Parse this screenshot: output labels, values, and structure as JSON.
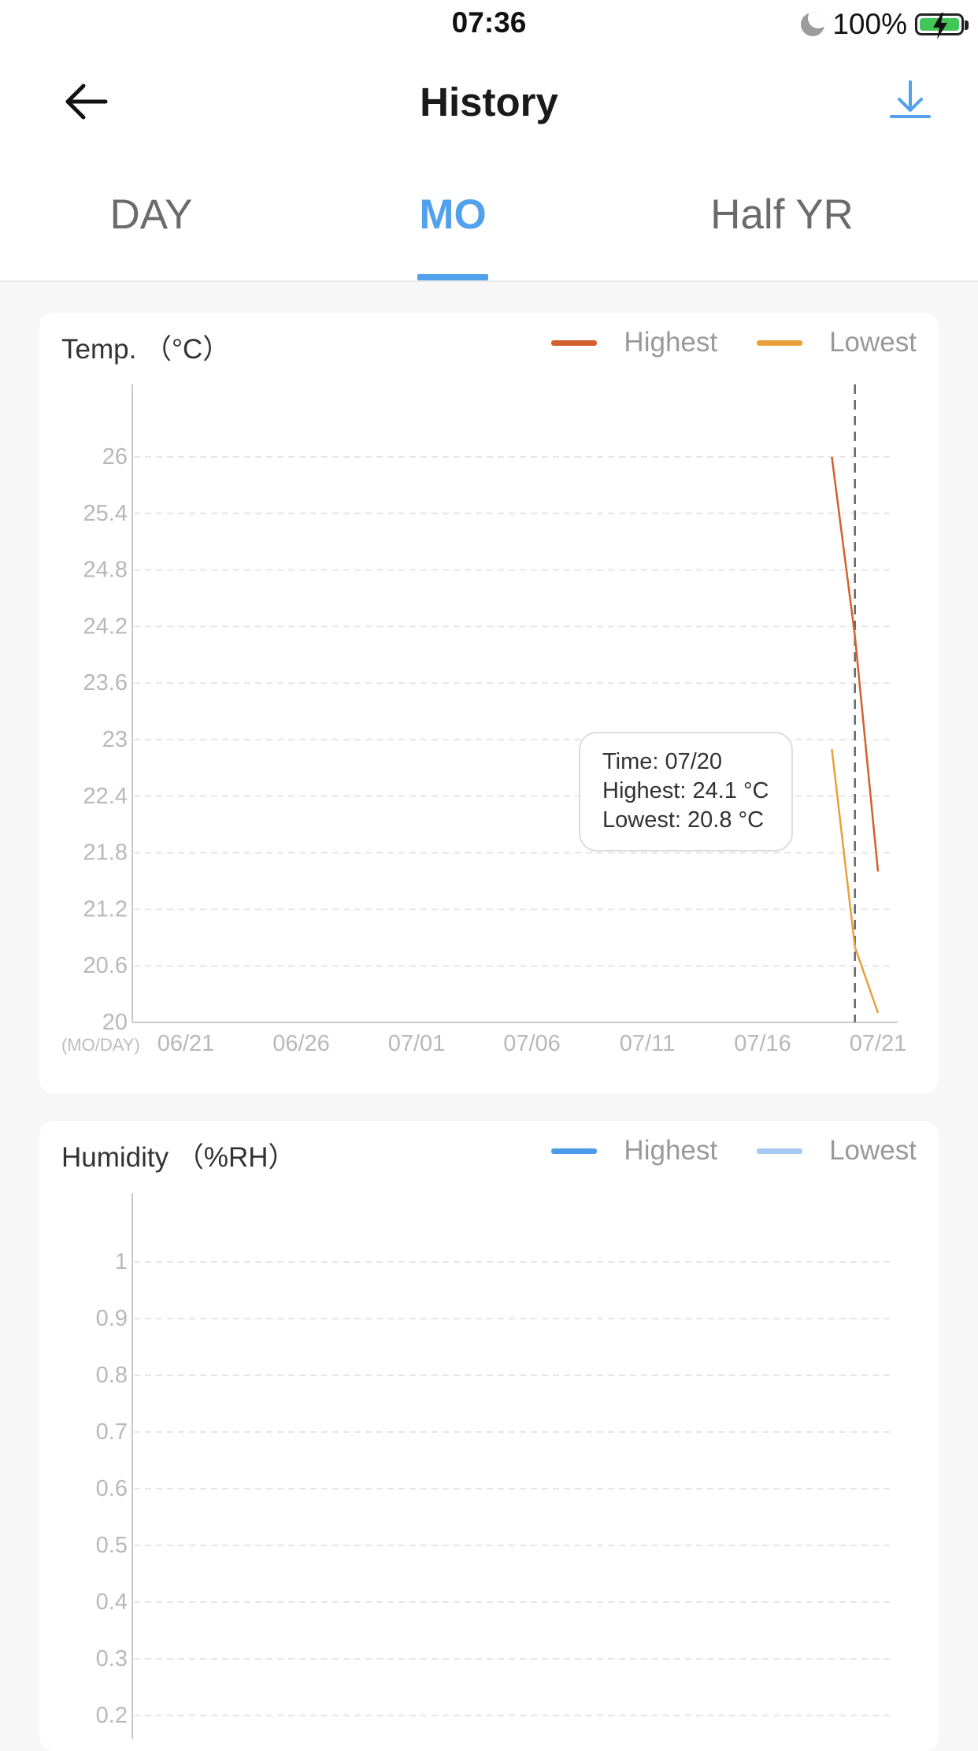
{
  "status": {
    "time": "07:36",
    "battery": "100%"
  },
  "nav": {
    "title": "History",
    "back_icon": "arrow-left-icon",
    "download_icon": "download-icon"
  },
  "tabs": [
    {
      "label": "DAY",
      "active": false
    },
    {
      "label": "MO",
      "active": true
    },
    {
      "label": "Half YR",
      "active": false
    }
  ],
  "colors": {
    "accent": "#52a1ec",
    "temp_highest": "#d2612f",
    "temp_lowest": "#e9a03a",
    "hum_highest": "#4c9be8",
    "hum_lowest": "#a7c8f2"
  },
  "temp_card": {
    "title": "Temp. （°C）",
    "legend": {
      "highest": "Highest",
      "lowest": "Lowest"
    },
    "tooltip": {
      "time": "Time: 07/20",
      "highest": "Highest: 24.1 °C",
      "lowest": "Lowest: 20.8 °C"
    },
    "x_unit_label": "(MO/DAY)"
  },
  "humidity_card": {
    "title": "Humidity （%RH）",
    "legend": {
      "highest": "Highest",
      "lowest": "Lowest"
    }
  },
  "chart_data": [
    {
      "type": "line",
      "title": "Temp. （°C）",
      "xlabel": "(MO/DAY)",
      "ylabel": "",
      "x_ticks": [
        "06/21",
        "06/26",
        "07/01",
        "07/06",
        "07/11",
        "07/16",
        "07/21"
      ],
      "y_ticks": [
        20,
        20.6,
        21.2,
        21.8,
        22.4,
        23,
        23.6,
        24.2,
        24.8,
        25.4,
        26
      ],
      "ylim": [
        20,
        26.6
      ],
      "grid": true,
      "legend_position": "top-right",
      "series": [
        {
          "name": "Highest",
          "points": [
            [
              "07/19",
              26.0
            ],
            [
              "07/20",
              24.1
            ],
            [
              "07/21",
              21.6
            ]
          ]
        },
        {
          "name": "Lowest",
          "points": [
            [
              "07/19",
              22.9
            ],
            [
              "07/20",
              20.8
            ],
            [
              "07/21",
              20.1
            ]
          ]
        }
      ],
      "cursor_x": "07/20"
    },
    {
      "type": "line",
      "title": "Humidity （%RH）",
      "xlabel": "",
      "ylabel": "",
      "y_ticks": [
        0.2,
        0.3,
        0.4,
        0.5,
        0.6,
        0.7,
        0.8,
        0.9,
        1
      ],
      "grid": true,
      "legend_position": "top-right",
      "series": [
        {
          "name": "Highest",
          "points": []
        },
        {
          "name": "Lowest",
          "points": []
        }
      ]
    }
  ]
}
